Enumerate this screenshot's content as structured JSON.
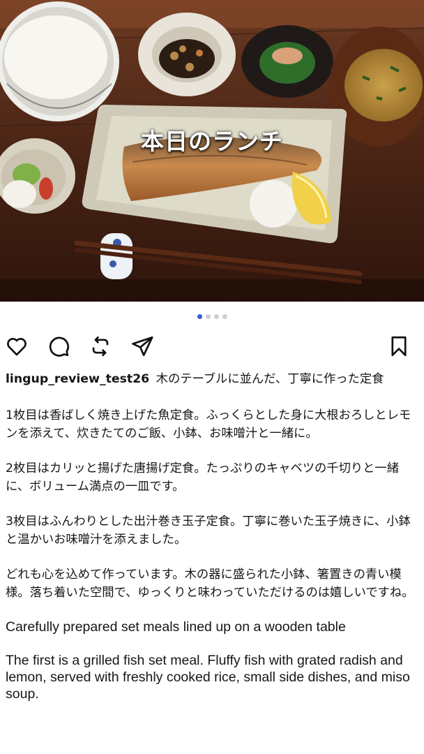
{
  "post": {
    "image_title": "本日のランチ",
    "carousel": {
      "total": 4,
      "active": 1
    },
    "username": "lingup_review_test26",
    "caption_lead": "木のテーブルに並んだ、丁寧に作った定食",
    "paragraphs_ja": [
      "1枚目は香ばしく焼き上げた魚定食。ふっくらとした身に大根おろしとレモンを添えて、炊きたてのご飯、小鉢、お味噌汁と一緒に。",
      "2枚目はカリッと揚げた唐揚げ定食。たっぷりのキャベツの千切りと一緒に、ボリューム満点の一皿です。",
      "3枚目はふんわりとした出汁巻き玉子定食。丁寧に巻いた玉子焼きに、小鉢と温かいお味噌汁を添えました。",
      "どれも心を込めて作っています。木の器に盛られた小鉢、箸置きの青い模様。落ち着いた空間で、ゆっくりと味わっていただけるのは嬉しいですね。"
    ],
    "en_title": "Carefully prepared set meals lined up on a wooden table",
    "en_paragraph_1": "The first is a grilled fish set meal. Fluffy fish with grated radish and lemon, served with freshly cooked rice, small side dishes, and miso soup."
  },
  "icons": [
    "heart-icon",
    "comment-icon",
    "repost-icon",
    "send-icon",
    "bookmark-icon"
  ]
}
